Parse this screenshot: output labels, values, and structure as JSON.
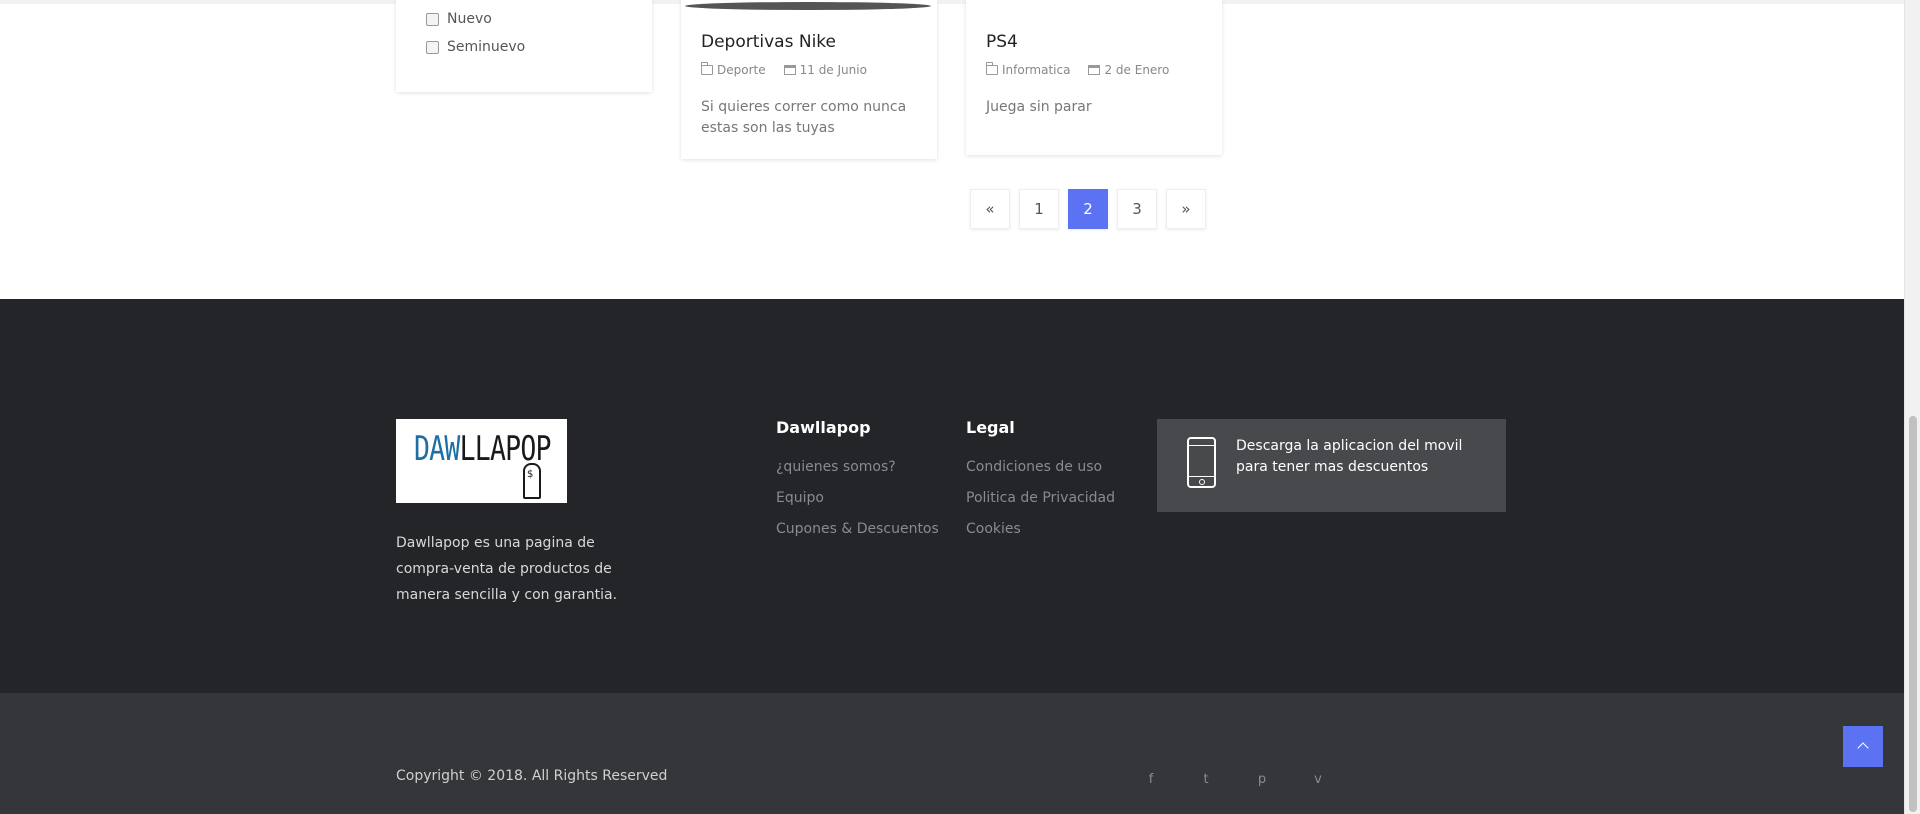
{
  "filter": {
    "options": [
      {
        "label": "Nuevo",
        "checked": false
      },
      {
        "label": "Seminuevo",
        "checked": false
      }
    ]
  },
  "products": [
    {
      "title": "Deportivas Nike",
      "category": "Deporte",
      "date": "11 de Junio",
      "description": "Si quieres correr como nunca estas son las tuyas"
    },
    {
      "title": "PS4",
      "category": "Informatica",
      "date": "2 de Enero",
      "description": "Juega sin parar"
    }
  ],
  "pagination": {
    "prev": "«",
    "pages": [
      "1",
      "2",
      "3"
    ],
    "current": "2",
    "next": "»"
  },
  "footer": {
    "logo": {
      "part1": "DAW",
      "part2": "LLAPOP"
    },
    "about": "Dawllapop es una pagina de compra-venta de productos de manera sencilla y con garantia.",
    "columns": [
      {
        "title": "Dawllapop",
        "links": [
          "¿quienes somos?",
          "Equipo",
          "Cupones & Descuentos"
        ]
      },
      {
        "title": "Legal",
        "links": [
          "Condiciones de uso",
          "Politica de Privacidad",
          "Cookies"
        ]
      }
    ],
    "app_promo": "Descarga la aplicacion del movil para tener mas descuentos",
    "copyright": "Copyright © 2018. All Rights Reserved",
    "social": [
      {
        "icon": "facebook-icon",
        "glyph": "f"
      },
      {
        "icon": "twitter-icon",
        "glyph": "t"
      },
      {
        "icon": "pinterest-icon",
        "glyph": "p"
      },
      {
        "icon": "vimeo-icon",
        "glyph": "v"
      }
    ]
  },
  "colors": {
    "accent": "#5b73f2",
    "footer_bg": "#242528",
    "footer_bottom_bg": "#35363a",
    "logo_blue": "#1d6fa5"
  }
}
